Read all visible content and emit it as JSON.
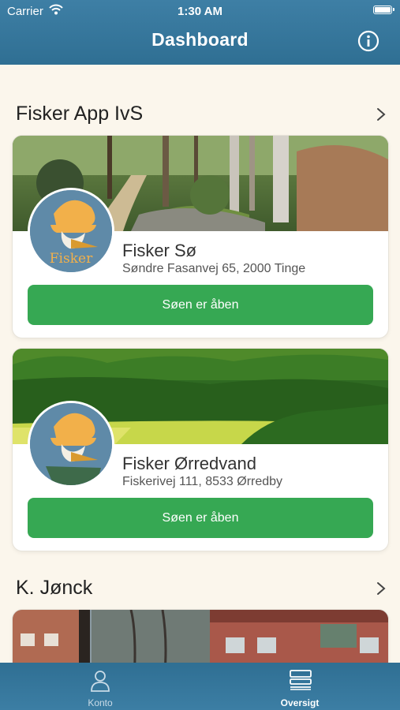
{
  "status_bar": {
    "carrier": "Carrier",
    "time": "1:30 AM"
  },
  "nav": {
    "title": "Dashboard",
    "info_icon": "info-circle-icon"
  },
  "sections": [
    {
      "title": "Fisker App IvS",
      "lakes": [
        {
          "name": "Fisker Sø",
          "address": "Søndre Fasanvej 65, 2000 Tinge",
          "button": "Søen er åben",
          "logo_text": "Fisker"
        },
        {
          "name": "Fisker Ørredvand",
          "address": "Fiskerivej 111, 8533 Ørredby",
          "button": "Søen er åben"
        }
      ]
    },
    {
      "title": "K. Jønck",
      "lakes": []
    }
  ],
  "tabs": [
    {
      "label": "Konto",
      "icon": "person-icon"
    },
    {
      "label": "Oversigt",
      "icon": "list-icon"
    }
  ],
  "colors": {
    "nav": "#3a7aa0",
    "button": "#36a853",
    "background": "#fbf6ec"
  }
}
